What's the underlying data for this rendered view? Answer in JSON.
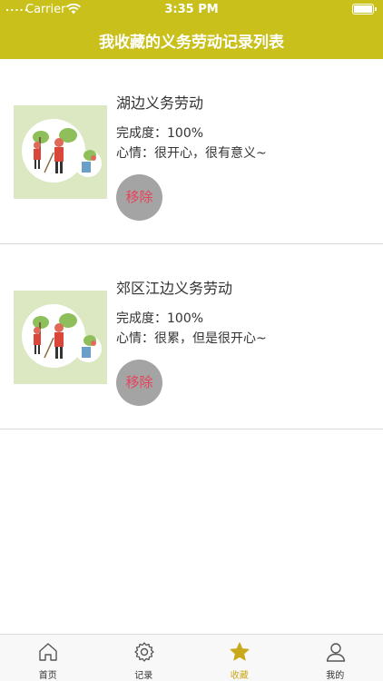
{
  "status_bar": {
    "carrier": "Carrier",
    "time": "3:35 PM",
    "signal_dots": "....."
  },
  "header": {
    "title": "我收藏的义务劳动记录列表",
    "background_color": "#c9c01c"
  },
  "records": [
    {
      "title": "湖边义务劳动",
      "progress": "完成度：100%",
      "mood": "心情：很开心，很有意义~",
      "remove_label": "移除",
      "image_icon": "volunteer-cleaning-image"
    },
    {
      "title": "郊区江边义务劳动",
      "progress": "完成度：100%",
      "mood": "心情：很累，但是很开心~",
      "remove_label": "移除",
      "image_icon": "volunteer-cleaning-image"
    }
  ],
  "tabbar": {
    "active_color": "#c9a81c",
    "tabs": [
      {
        "label": "首页",
        "icon": "home-icon",
        "active": false
      },
      {
        "label": "记录",
        "icon": "gear-icon",
        "active": false
      },
      {
        "label": "收藏",
        "icon": "star-icon",
        "active": true
      },
      {
        "label": "我的",
        "icon": "user-icon",
        "active": false
      }
    ]
  }
}
